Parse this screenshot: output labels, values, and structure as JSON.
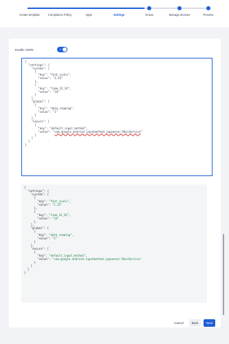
{
  "stepper": {
    "steps": [
      {
        "label": "Create template"
      },
      {
        "label": "Compliance Policy"
      },
      {
        "label": "Apps"
      },
      {
        "label": "Settings"
      },
      {
        "label": "Group"
      },
      {
        "label": "Manage devices"
      },
      {
        "label": "Preview"
      }
    ]
  },
  "settings": {
    "toggle_label": "Enable JSON",
    "toggle_on": true,
    "editor_text": "{\n  \"settings\": {\n    \"system\": [\n      {\n        \"key\": \"font_scale\",\n        \"value\": \"1.35\"\n      },\n      {\n        \"key\": \"time_12_24\",\n        \"value\": \"24\"\n      }\n    ],\n    \"global\": [\n      {\n        \"key\": \"data_roaming\",\n        \"value\": \"1\"\n      }\n    ],\n    \"secure\": [\n      {\n        \"key\": \"default_input_method\",\n        \"value\": \"com.google.android.inputmethod.japanese/.MozcService\"\n      }\n    ]\n  }\n}"
  },
  "preview": {
    "lines": [
      {
        "pre": "{",
        "str": "",
        "post": ""
      },
      {
        "pre": "  \"settings\": {",
        "str": "",
        "post": ""
      },
      {
        "pre": "    \"system\": [",
        "str": "",
        "post": ""
      },
      {
        "pre": "      {",
        "str": "",
        "post": ""
      },
      {
        "pre": "        \"key\": ",
        "str": "\"font_scale\"",
        "post": ","
      },
      {
        "pre": "        \"value\": ",
        "str": "\"1.35\"",
        "post": ""
      },
      {
        "pre": "      },",
        "str": "",
        "post": ""
      },
      {
        "pre": "      {",
        "str": "",
        "post": ""
      },
      {
        "pre": "        \"key\": ",
        "str": "\"time_12_24\"",
        "post": ","
      },
      {
        "pre": "        \"value\": ",
        "str": "\"24\"",
        "post": ""
      },
      {
        "pre": "      }",
        "str": "",
        "post": ""
      },
      {
        "pre": "    ],",
        "str": "",
        "post": ""
      },
      {
        "pre": "    \"global\": [",
        "str": "",
        "post": ""
      },
      {
        "pre": "      {",
        "str": "",
        "post": ""
      },
      {
        "pre": "        \"key\": ",
        "str": "\"data_roaming\"",
        "post": ","
      },
      {
        "pre": "        \"value\": ",
        "str": "\"1\"",
        "post": ""
      },
      {
        "pre": "      }",
        "str": "",
        "post": ""
      },
      {
        "pre": "    ],",
        "str": "",
        "post": ""
      },
      {
        "pre": "    \"secure\": [",
        "str": "",
        "post": ""
      },
      {
        "pre": "      {",
        "str": "",
        "post": ""
      },
      {
        "pre": "        \"key\": ",
        "str": "\"default_input_method\"",
        "post": ","
      },
      {
        "pre": "        \"value\": ",
        "str": "\"com.google.android.inputmethod.japanese/.MozcService\"",
        "post": ""
      },
      {
        "pre": "      }",
        "str": "",
        "post": ""
      },
      {
        "pre": "    ]",
        "str": "",
        "post": ""
      },
      {
        "pre": "  }",
        "str": "",
        "post": ""
      },
      {
        "pre": "}",
        "str": "",
        "post": ""
      }
    ]
  },
  "actions": {
    "cancel": "Cancel",
    "back": "Back",
    "next": "Next"
  },
  "colors": {
    "accent": "#1f5fd6",
    "string_green": "#15803d",
    "error_red": "#dd3333"
  }
}
